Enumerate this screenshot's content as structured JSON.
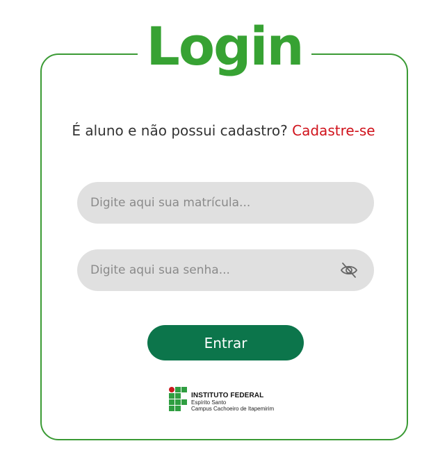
{
  "page": {
    "title": "Login"
  },
  "signup": {
    "question": "É aluno e não possui cadastro?",
    "link": "Cadastre-se"
  },
  "fields": {
    "matricula_placeholder": "Digite aqui sua matrícula...",
    "senha_placeholder": "Digite aqui sua senha...",
    "toggle_icon": "eye-off-icon"
  },
  "submit": {
    "label": "Entrar"
  },
  "institution": {
    "name": "INSTITUTO FEDERAL",
    "line1": "Espírito Santo",
    "line2": "Campus Cachoeiro de Itapemirim"
  },
  "colors": {
    "accent": "#37a233",
    "button": "#0c754b",
    "link": "#d0121b",
    "field": "#e0e0e0"
  }
}
